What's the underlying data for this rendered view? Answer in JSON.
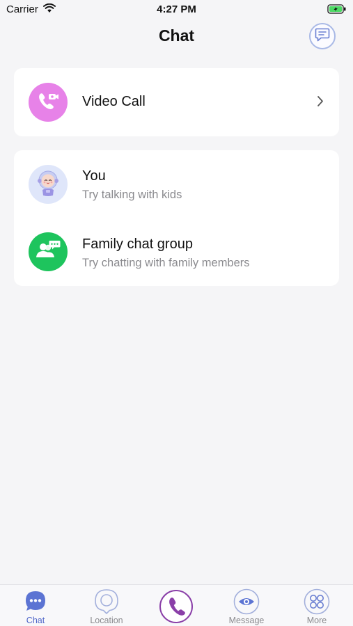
{
  "status_bar": {
    "carrier": "Carrier",
    "time": "4:27 PM"
  },
  "header": {
    "title": "Chat"
  },
  "video_call": {
    "label": "Video Call"
  },
  "contacts": [
    {
      "title": "You",
      "subtitle": "Try talking with kids"
    },
    {
      "title": "Family chat group",
      "subtitle": "Try chatting with family members"
    }
  ],
  "tabs": [
    {
      "label": "Chat",
      "icon": "chat-icon",
      "active": true
    },
    {
      "label": "Location",
      "icon": "location-icon",
      "active": false
    },
    {
      "label": "",
      "icon": "phone-icon",
      "active": false
    },
    {
      "label": "Message",
      "icon": "eye-icon",
      "active": false
    },
    {
      "label": "More",
      "icon": "grid-icon",
      "active": false
    }
  ],
  "colors": {
    "accent": "#4f66c9",
    "video_call_avatar": "#e782e8",
    "family_avatar": "#1ec45d",
    "call_button": "#8a3fa8"
  }
}
